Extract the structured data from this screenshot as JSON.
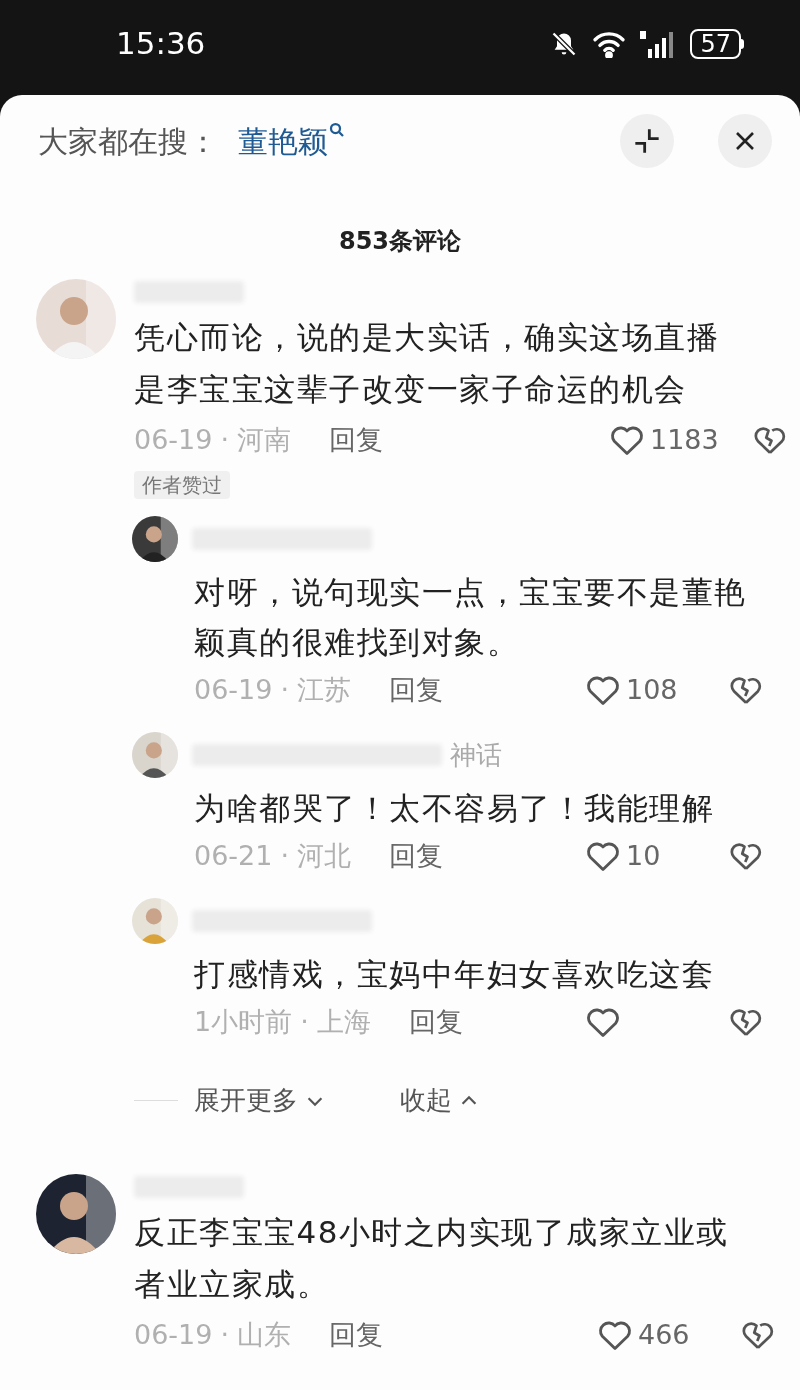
{
  "status_bar": {
    "time": "15:36",
    "battery": "57"
  },
  "search_bar": {
    "prefix": "大家都在搜：",
    "query": "董艳颖"
  },
  "title": "853条评论",
  "comments": [
    {
      "text": "凭心而论，说的是大实话，确实这场直播是李宝宝这辈子改变一家子命运的机会",
      "date": "06-19",
      "separator": "·",
      "region": "河南",
      "reply_label": "回复",
      "likes": "1183",
      "badge": "作者赞过",
      "replies": [
        {
          "text": "对呀，说句现实一点，宝宝要不是董艳颖真的很难找到对象。",
          "date": "06-19",
          "separator": "·",
          "region": "江苏",
          "reply_label": "回复",
          "likes": "108"
        },
        {
          "name_fragment": "神话",
          "text": "为啥都哭了！太不容易了！我能理解",
          "date": "06-21",
          "separator": "·",
          "region": "河北",
          "reply_label": "回复",
          "likes": "10"
        },
        {
          "text": "打感情戏，宝妈中年妇女喜欢吃这套",
          "date": "1小时前",
          "separator": "·",
          "region": "上海",
          "reply_label": "回复"
        }
      ],
      "expand": {
        "more": "展开更多",
        "collapse": "收起"
      }
    },
    {
      "text": "反正李宝宝48小时之内实现了成家立业或者业立家成。",
      "date": "06-19",
      "separator": "·",
      "region": "山东",
      "reply_label": "回复",
      "likes": "466"
    }
  ]
}
